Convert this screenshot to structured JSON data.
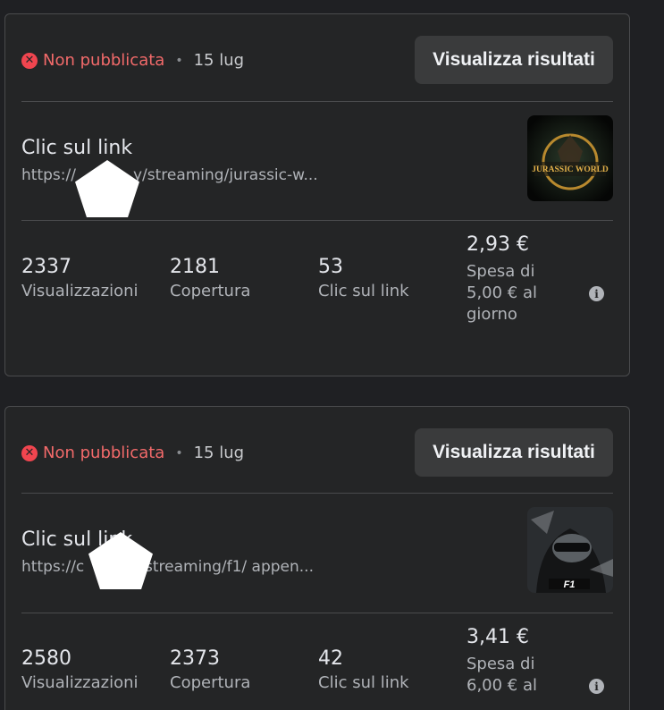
{
  "ads": [
    {
      "status": "Non pubblicata",
      "date": "15 lug",
      "results_button": "Visualizza risultati",
      "objective": "Clic sul link",
      "url_start": "https://",
      "url_end": "y/streaming/jurassic-w...",
      "thumbnail_text": "JURASSIC WORLD",
      "metrics": [
        {
          "value": "2337",
          "label": "Visualizzazioni"
        },
        {
          "value": "2181",
          "label": "Copertura"
        },
        {
          "value": "53",
          "label": "Clic sul link"
        }
      ],
      "spend": {
        "value": "2,93 €",
        "label": "Spesa di 5,00 € al giorno"
      }
    },
    {
      "status": "Non pubblicata",
      "date": "15 lug",
      "results_button": "Visualizza risultati",
      "objective": "Clic sul link",
      "url_start": "https://c",
      "url_end": "/streaming/f1/ appen...",
      "thumbnail_text": "F1",
      "metrics": [
        {
          "value": "2580",
          "label": "Visualizzazioni"
        },
        {
          "value": "2373",
          "label": "Copertura"
        },
        {
          "value": "42",
          "label": "Clic sul link"
        }
      ],
      "spend": {
        "value": "3,41 €",
        "label": "Spesa di 6,00 € al"
      }
    }
  ],
  "icons": {
    "status": "error-x-icon",
    "info": "info-icon"
  },
  "colors": {
    "status": "#f26a6a",
    "error_icon": "#f0454f",
    "card_bg": "#242526",
    "button_bg": "#3a3b3c"
  }
}
